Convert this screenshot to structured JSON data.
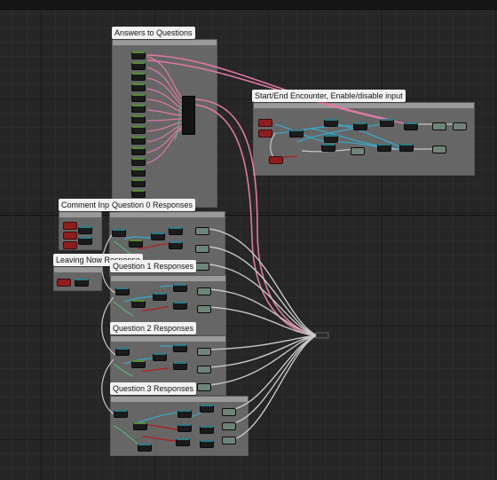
{
  "comments": {
    "answers": "Answers to Questions",
    "encounter": "Start/End Encounter, Enable/disable input",
    "comment_input": "Comment Input",
    "q0": "Question 0 Responses",
    "leaving": "Leaving Now Response",
    "q1": "Question 1 Responses",
    "q2": "Question 2 Responses",
    "q3": "Question 3 Responses"
  },
  "colors": {
    "exec_wire": "#e07aa4",
    "data_wire": "#c8c8c8",
    "bool_wire": "#3aa7c9",
    "red_wire": "#b01e1e"
  }
}
